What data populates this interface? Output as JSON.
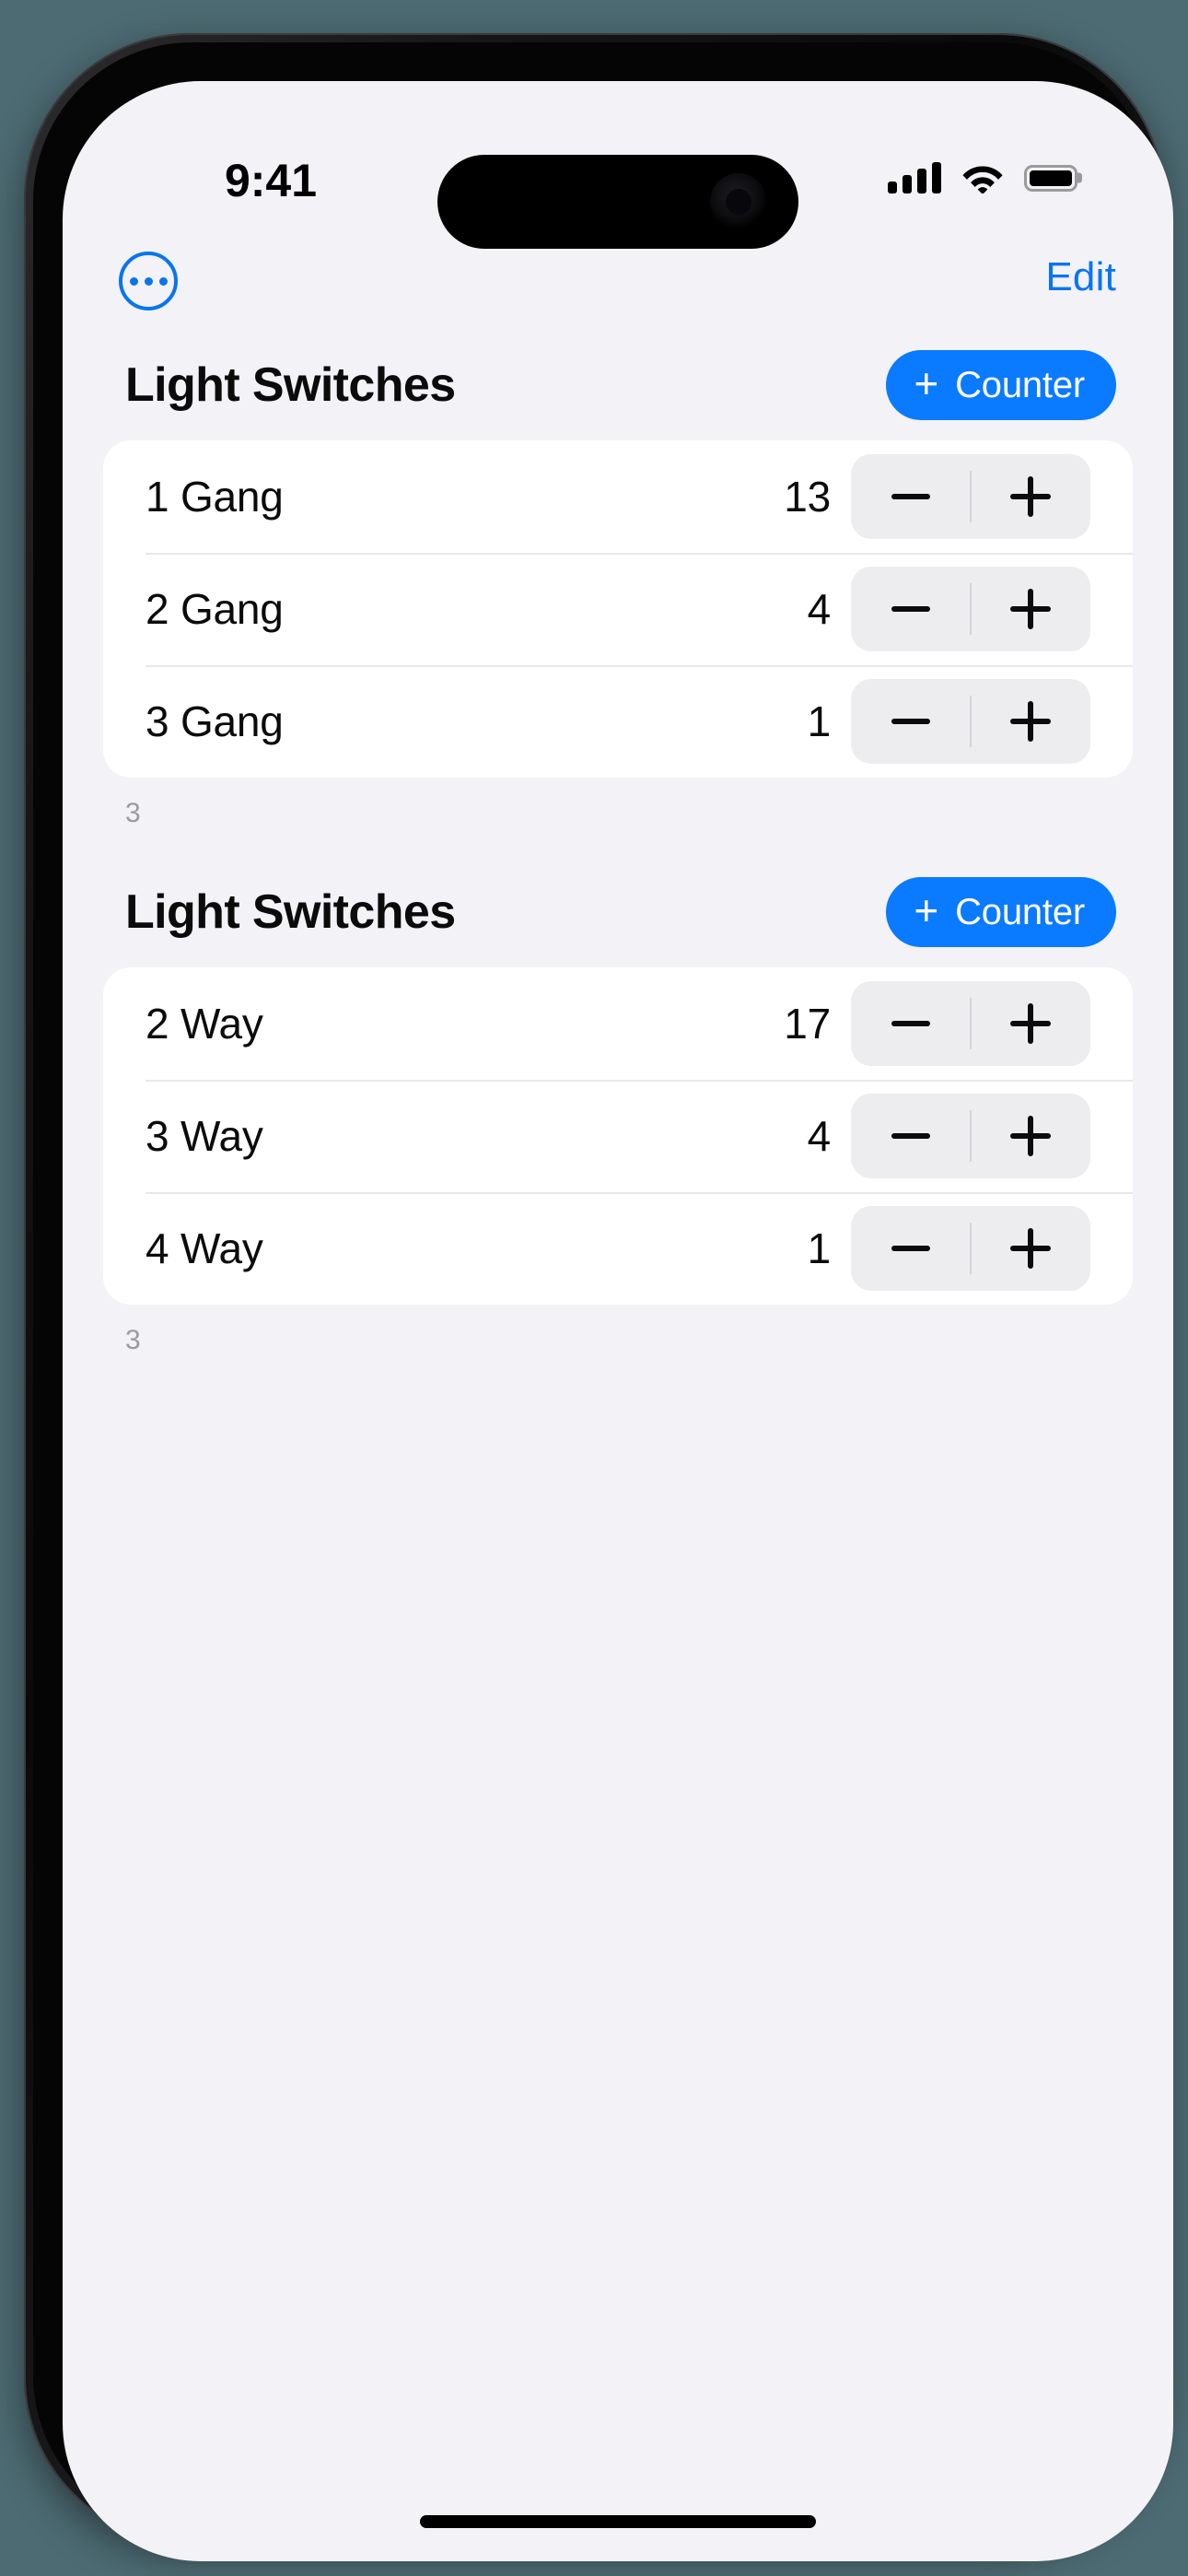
{
  "status_bar": {
    "time": "9:41",
    "cellular_icon": "cellular-bars-icon",
    "cellular_bars": 4,
    "wifi_icon": "wifi-icon",
    "battery_icon": "battery-full-icon",
    "battery_level": 100
  },
  "nav_bar": {
    "more_options_icon": "ellipsis-circle-icon",
    "edit_label": "Edit"
  },
  "theme": {
    "accent_blue": "#0a7aff",
    "screen_background": "#f2f2f7",
    "card_background": "#ffffff",
    "stepper_background": "#ededf0",
    "footer_text": "#9a9aa0"
  },
  "sections": [
    {
      "title": "Light Switches",
      "add_button_label": "Counter",
      "add_button_icon": "plus-icon",
      "footer": "3",
      "rows": [
        {
          "label": "1 Gang",
          "value": "13",
          "minus_icon": "minus-icon",
          "plus_icon": "plus-icon"
        },
        {
          "label": "2 Gang",
          "value": "4",
          "minus_icon": "minus-icon",
          "plus_icon": "plus-icon"
        },
        {
          "label": "3 Gang",
          "value": "1",
          "minus_icon": "minus-icon",
          "plus_icon": "plus-icon"
        }
      ]
    },
    {
      "title": "Light Switches",
      "add_button_label": "Counter",
      "add_button_icon": "plus-icon",
      "footer": "3",
      "rows": [
        {
          "label": "2 Way",
          "value": "17",
          "minus_icon": "minus-icon",
          "plus_icon": "plus-icon"
        },
        {
          "label": "3 Way",
          "value": "4",
          "minus_icon": "minus-icon",
          "plus_icon": "plus-icon"
        },
        {
          "label": "4 Way",
          "value": "1",
          "minus_icon": "minus-icon",
          "plus_icon": "plus-icon"
        }
      ]
    }
  ]
}
